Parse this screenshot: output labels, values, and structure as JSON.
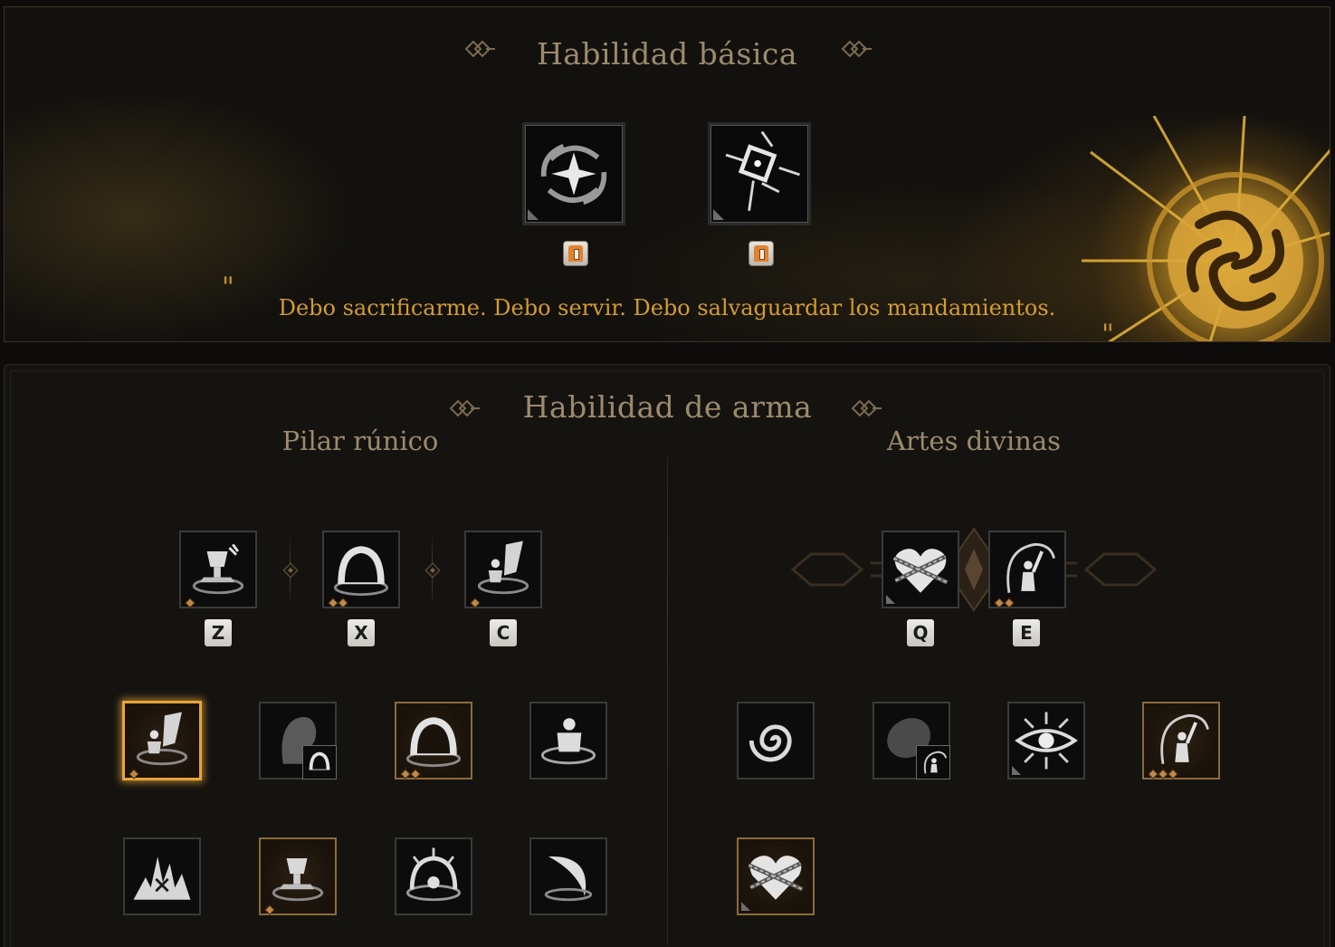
{
  "basic_ability": {
    "title": "Habilidad básica",
    "skills": [
      {
        "icon": "spiral-star-icon",
        "badge": "scroll-icon"
      },
      {
        "icon": "rune-sigil-icon",
        "badge": "scroll-icon"
      }
    ],
    "quote": "Debo sacrificarme. Debo servir. Debo salvaguardar los mandamientos.",
    "quote_open": "\"",
    "quote_close": "\""
  },
  "weapon_ability": {
    "title": "Habilidad de arma",
    "runic_pillar": {
      "title": "Pilar rúnico",
      "equipped": [
        {
          "icon": "chalice-crash-icon",
          "key": "Z"
        },
        {
          "icon": "dome-shield-icon",
          "key": "X"
        },
        {
          "icon": "rising-pillar-icon",
          "key": "C"
        }
      ],
      "pool": [
        {
          "icon": "rising-pillar-icon"
        },
        {
          "icon": "fist-dome-icon"
        },
        {
          "icon": "dome-shield-icon"
        },
        {
          "icon": "bust-figure-icon"
        },
        {
          "icon": "eruption-icon"
        },
        {
          "icon": "chalice-crash-icon"
        },
        {
          "icon": "spiked-dome-icon"
        },
        {
          "icon": "crescent-slash-icon"
        }
      ]
    },
    "divine_arts": {
      "title": "Artes divinas",
      "equipped": [
        {
          "icon": "chained-heart-icon",
          "key": "Q"
        },
        {
          "icon": "raised-arm-icon",
          "key": "E"
        }
      ],
      "pool": [
        {
          "icon": "swirl-icon"
        },
        {
          "icon": "dark-sphere-icon"
        },
        {
          "icon": "radiant-eye-icon"
        },
        {
          "icon": "raised-arm-icon"
        },
        {
          "icon": "chained-heart-icon"
        }
      ]
    }
  },
  "colors": {
    "title": "#9c8a6c",
    "quote": "#d49b30",
    "selected_border": "#e6a53a",
    "gold_glow": "#ffd24a"
  }
}
